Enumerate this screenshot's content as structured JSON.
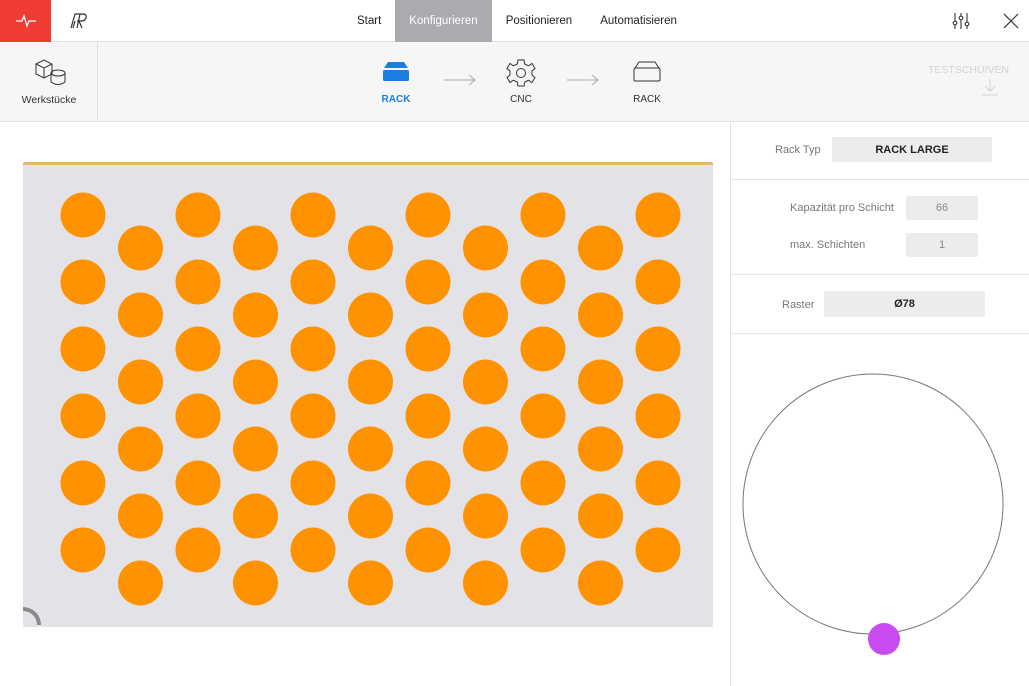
{
  "nav": {
    "tabs": [
      {
        "label": "Start",
        "active": false
      },
      {
        "label": "Konfigurieren",
        "active": true
      },
      {
        "label": "Positionieren",
        "active": false
      },
      {
        "label": "Automatisieren",
        "active": false
      }
    ],
    "accent_color": "#f03c32",
    "active_tab_color": "#a9abae",
    "icons": [
      "pulse-icon",
      "logo-icon",
      "sliders-icon",
      "close-icon"
    ]
  },
  "toolbar": {
    "workpieces_label": "Werkstücke",
    "steps": [
      {
        "label": "RACK",
        "icon": "rack-filled-icon",
        "active": true
      },
      {
        "label": "CNC",
        "icon": "gear-icon",
        "active": false
      },
      {
        "label": "RACK",
        "icon": "rack-outline-icon",
        "active": false
      }
    ],
    "test_label": "TESTSCHUIVEN",
    "active_color": "#1b7fe0"
  },
  "rack": {
    "columns": 11,
    "rows_even_columns": 6,
    "rows_odd_columns": 6,
    "hole_color": "#ff9200",
    "background_color": "#e3e2e6",
    "edge_color": "#e4b86c"
  },
  "panel": {
    "rack_type_label": "Rack Typ",
    "rack_type_value": "RACK LARGE",
    "capacity_label": "Kapazität pro Schicht",
    "capacity_value": "66",
    "max_layers_label": "max. Schichten",
    "max_layers_value": "1",
    "grid_label": "Raster",
    "grid_value": "Ø78",
    "marker_color": "#c84cf0"
  }
}
